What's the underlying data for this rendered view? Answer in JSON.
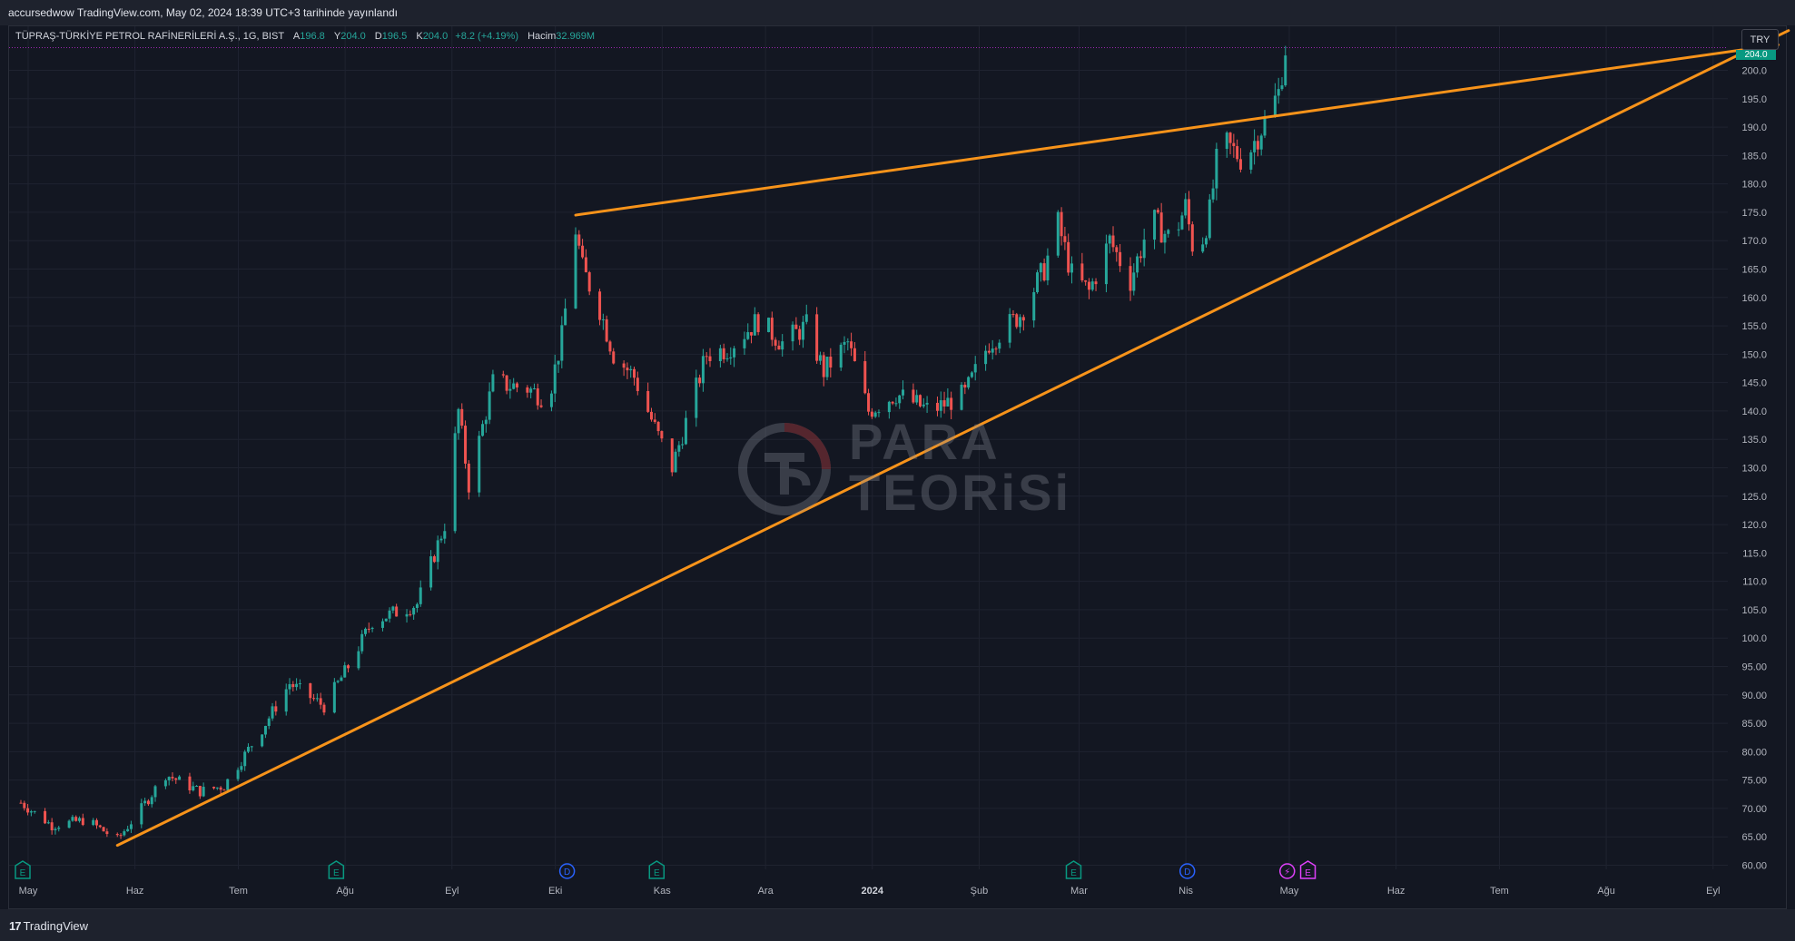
{
  "header": {
    "published_by": "accursedwow TradingView.com, May 02, 2024 18:39 UTC+3 tarihinde yayınlandı"
  },
  "legend": {
    "symbol": "TÜPRAŞ-TÜRKİYE PETROL RAFİNERİLERİ A.Ş., 1G, BIST",
    "open_label": "A",
    "open_value": "196.8",
    "high_label": "Y",
    "high_value": "204.0",
    "low_label": "D",
    "low_value": "196.5",
    "close_label": "K",
    "close_value": "204.0",
    "change": "+8.2 (+4.19%)",
    "volume_label": "Hacim",
    "volume_value": "32.969M"
  },
  "currency_button": "TRY",
  "last_price_tag": "204.0",
  "watermark": {
    "line1": "PARA",
    "line2": "TEORiSi"
  },
  "footer": {
    "brand": "TradingView",
    "brand_mark": "17"
  },
  "colors": {
    "background": "#131722",
    "up": "#26a69a",
    "down": "#ef5350",
    "trendline": "#f7931a",
    "grid": "#1f2330",
    "earnings_marker": "#089981",
    "dividend_marker": "#2962ff",
    "split_marker": "#e040fb"
  },
  "chart_data": {
    "type": "candlestick",
    "title": "",
    "symbol": "TÜPRAŞ",
    "interval": "1G",
    "exchange": "BIST",
    "currency": "TRY",
    "ylim": [
      57.5,
      207.5
    ],
    "y_ticks": [
      "60.00",
      "65.00",
      "70.00",
      "75.00",
      "80.00",
      "85.00",
      "90.00",
      "95.00",
      "100.0",
      "105.0",
      "110.0",
      "115.0",
      "120.0",
      "125.0",
      "130.0",
      "135.0",
      "140.0",
      "145.0",
      "150.0",
      "155.0",
      "160.0",
      "165.0",
      "170.0",
      "175.0",
      "180.0",
      "185.0",
      "190.0",
      "195.0",
      "200.0"
    ],
    "x_ticks": [
      "May",
      "Haz",
      "Tem",
      "Ağu",
      "Eyl",
      "Eki",
      "Kas",
      "Ara",
      "2024",
      "Şub",
      "Mar",
      "Nis",
      "May",
      "Haz",
      "Tem",
      "Ağu",
      "Eyl"
    ],
    "grid": true,
    "price_path_anchors": [
      {
        "date": "2023-05-01",
        "close": 71
      },
      {
        "date": "2023-05-10",
        "close": 67
      },
      {
        "date": "2023-05-20",
        "close": 68
      },
      {
        "date": "2023-05-29",
        "close": 64.5
      },
      {
        "date": "2023-06-05",
        "close": 70
      },
      {
        "date": "2023-06-12",
        "close": 76
      },
      {
        "date": "2023-06-22",
        "close": 73
      },
      {
        "date": "2023-06-29",
        "close": 74
      },
      {
        "date": "2023-07-10",
        "close": 84
      },
      {
        "date": "2023-07-18",
        "close": 92
      },
      {
        "date": "2023-07-28",
        "close": 88
      },
      {
        "date": "2023-08-04",
        "close": 95
      },
      {
        "date": "2023-08-11",
        "close": 103
      },
      {
        "date": "2023-08-24",
        "close": 106
      },
      {
        "date": "2023-09-01",
        "close": 120
      },
      {
        "date": "2023-09-05",
        "close": 140
      },
      {
        "date": "2023-09-08",
        "close": 127
      },
      {
        "date": "2023-09-15",
        "close": 145
      },
      {
        "date": "2023-09-25",
        "close": 144
      },
      {
        "date": "2023-10-01",
        "close": 142
      },
      {
        "date": "2023-10-05",
        "close": 153
      },
      {
        "date": "2023-10-09",
        "close": 172
      },
      {
        "date": "2023-10-11",
        "close": 165
      },
      {
        "date": "2023-10-16",
        "close": 158
      },
      {
        "date": "2023-10-20",
        "close": 150
      },
      {
        "date": "2023-10-26",
        "close": 146
      },
      {
        "date": "2023-11-01",
        "close": 137
      },
      {
        "date": "2023-11-06",
        "close": 130
      },
      {
        "date": "2023-11-10",
        "close": 138
      },
      {
        "date": "2023-11-16",
        "close": 150
      },
      {
        "date": "2023-11-22",
        "close": 151
      },
      {
        "date": "2023-12-01",
        "close": 156
      },
      {
        "date": "2023-12-08",
        "close": 152
      },
      {
        "date": "2023-12-15",
        "close": 155
      },
      {
        "date": "2023-12-20",
        "close": 147
      },
      {
        "date": "2023-12-27",
        "close": 152
      },
      {
        "date": "2024-01-02",
        "close": 140
      },
      {
        "date": "2024-01-10",
        "close": 143
      },
      {
        "date": "2024-01-20",
        "close": 140
      },
      {
        "date": "2024-01-30",
        "close": 143
      },
      {
        "date": "2024-02-06",
        "close": 152
      },
      {
        "date": "2024-02-15",
        "close": 157
      },
      {
        "date": "2024-02-22",
        "close": 165
      },
      {
        "date": "2024-02-26",
        "close": 173
      },
      {
        "date": "2024-03-01",
        "close": 164
      },
      {
        "date": "2024-03-06",
        "close": 161
      },
      {
        "date": "2024-03-12",
        "close": 170
      },
      {
        "date": "2024-03-18",
        "close": 163
      },
      {
        "date": "2024-03-24",
        "close": 174
      },
      {
        "date": "2024-03-30",
        "close": 170
      },
      {
        "date": "2024-04-03",
        "close": 176
      },
      {
        "date": "2024-04-06",
        "close": 166
      },
      {
        "date": "2024-04-10",
        "close": 175
      },
      {
        "date": "2024-04-13",
        "close": 188
      },
      {
        "date": "2024-04-20",
        "close": 184
      },
      {
        "date": "2024-04-26",
        "close": 191
      },
      {
        "date": "2024-04-30",
        "close": 196
      },
      {
        "date": "2024-05-02",
        "close": 204
      }
    ],
    "trendlines": [
      {
        "name": "",
        "from": {
          "date": "2023-05-29",
          "price": 63.5
        },
        "to": {
          "date": "2024-09-25",
          "price": 207.0
        }
      },
      {
        "name": "",
        "from": {
          "date": "2023-10-09",
          "price": 174.5
        },
        "to": {
          "date": "2024-09-22",
          "price": 204.5
        }
      }
    ],
    "event_markers": [
      {
        "date": "2023-05-01",
        "label": "E"
      },
      {
        "date": "2023-07-31",
        "label": "E"
      },
      {
        "date": "2023-10-06",
        "label": "D"
      },
      {
        "date": "2023-11-01",
        "label": "E"
      },
      {
        "date": "2024-03-01",
        "label": "E"
      },
      {
        "date": "2024-04-03",
        "label": "D"
      },
      {
        "date": "2024-05-02",
        "label": "⚡"
      },
      {
        "date": "2024-05-08",
        "label": "E"
      }
    ],
    "price_line": 204.0
  }
}
